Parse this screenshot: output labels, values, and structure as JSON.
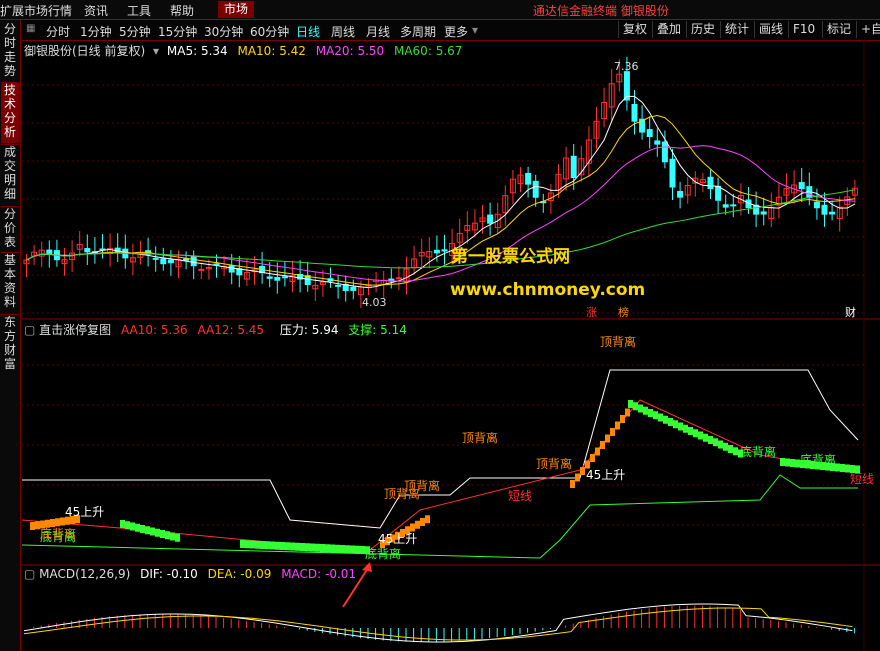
{
  "topbar": {
    "left_items": [
      "扩展市场行情",
      "资讯",
      "工具",
      "帮助"
    ],
    "market_label": "市场",
    "right_text": "通达信金融终端  御银股份"
  },
  "periods": [
    "分时",
    "1分钟",
    "5分钟",
    "15分钟",
    "30分钟",
    "60分钟",
    "日线",
    "周线",
    "月线",
    "多周期",
    "更多"
  ],
  "active_period": "日线",
  "toolbar": [
    "复权",
    "叠加",
    "历史",
    "统计",
    "画线",
    "F10",
    "标记"
  ],
  "toolbar_right": "+自",
  "sidebar": [
    "分时走势",
    "技术分析",
    "成交明细",
    "分价表",
    "基本资料",
    "东方财富"
  ],
  "sidebar_active": "技术分析",
  "main": {
    "title": "御银股份(日线 前复权)",
    "ma": [
      {
        "name": "MA5",
        "value": "5.34",
        "color": "#ffffff"
      },
      {
        "name": "MA10",
        "value": "5.42",
        "color": "#ffd700"
      },
      {
        "name": "MA20",
        "value": "5.50",
        "color": "#ff44ff"
      },
      {
        "name": "MA60",
        "value": "5.67",
        "color": "#33dd33"
      }
    ],
    "high_label": "7.36",
    "low_label": "4.03",
    "tags": [
      "涨",
      "榜",
      "财"
    ]
  },
  "watermark": {
    "line1": "第一股票公式网",
    "line2": "www.chnmoney.com"
  },
  "panel2": {
    "title": "直击涨停复图",
    "aa10_label": "AA10: 5.36",
    "aa12_label": "AA12: 5.45",
    "pressure_label": "压力: 5.94",
    "support_label": "支撑: 5.14",
    "labels": [
      "顶背离",
      "顶背离",
      "顶背离",
      "顶背离",
      "顶背离",
      "底背离",
      "底背离",
      "底背离",
      "底背离",
      "短线",
      "短线",
      "45上升",
      "45上升",
      "45上升",
      "底背离"
    ]
  },
  "panel3": {
    "title": "MACD(12,26,9)",
    "dif_label": "DIF: -0.10",
    "dea_label": "DEA: -0.09",
    "macd_label": "MACD: -0.01"
  },
  "colors": {
    "up": "#ff3030",
    "down": "#33ffff",
    "ma5": "#ffffff",
    "ma10": "#ffd700",
    "ma20": "#ff44ff",
    "ma60": "#33dd33",
    "orange": "#ff8800",
    "green": "#33ff33"
  }
}
